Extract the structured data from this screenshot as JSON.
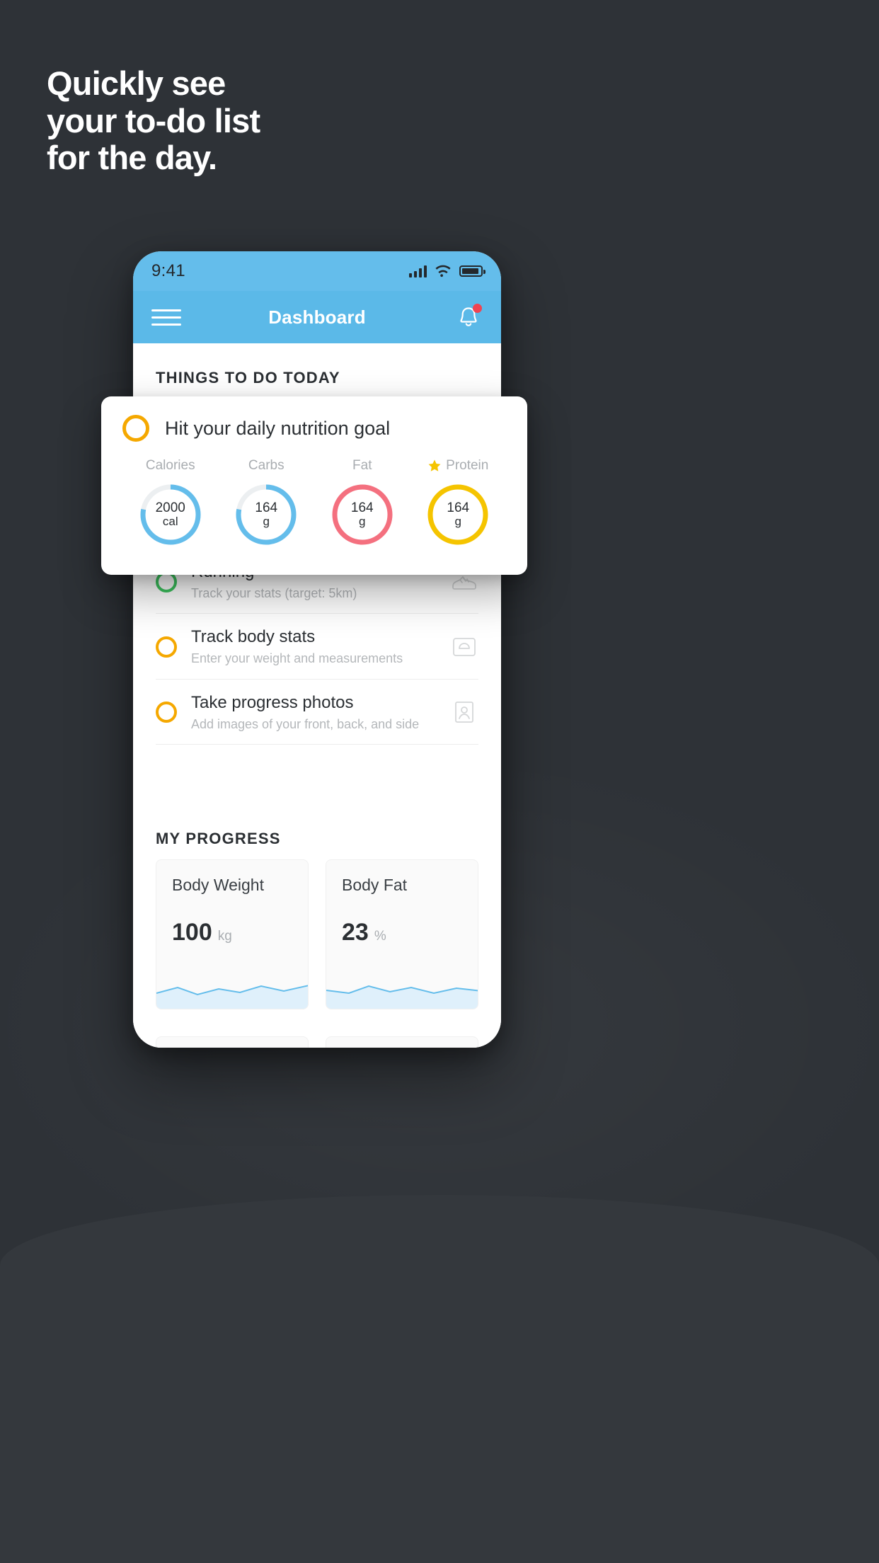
{
  "headline": {
    "line1": "Quickly see",
    "line2": "your to-do list",
    "line3": "for the day."
  },
  "colors": {
    "background": "#2e3237",
    "header_blue": "#5bb9e8",
    "status_blue": "#64bdeb",
    "amber": "#f5a800",
    "green": "#3dc45f",
    "red": "#f4707f",
    "light_blue": "#64bdeb",
    "yellow": "#f5c400",
    "notification_dot": "#ef4452"
  },
  "phone": {
    "status_bar": {
      "time": "9:41",
      "signal_icon": "cellular-signal-icon",
      "wifi_icon": "wifi-icon",
      "battery_icon": "battery-icon"
    },
    "app_bar": {
      "menu_icon": "hamburger-menu-icon",
      "title": "Dashboard",
      "bell_icon": "notification-bell-icon",
      "has_notification": true
    },
    "sections": {
      "todo_title": "THINGS TO DO TODAY",
      "progress_title": "MY PROGRESS"
    },
    "tasks": [
      {
        "title": "Running",
        "subtitle": "Track your stats (target: 5km)",
        "check_color": "#3dc45f",
        "icon": "running-shoe-icon"
      },
      {
        "title": "Track body stats",
        "subtitle": "Enter your weight and measurements",
        "check_color": "#f5a800",
        "icon": "scale-icon"
      },
      {
        "title": "Take progress photos",
        "subtitle": "Add images of your front, back, and side",
        "check_color": "#f5a800",
        "icon": "photo-portrait-icon"
      }
    ],
    "progress_cards": [
      {
        "label": "Body Weight",
        "value": "100",
        "unit": "kg"
      },
      {
        "label": "Body Fat",
        "value": "23",
        "unit": "%"
      }
    ]
  },
  "nutrition_card": {
    "check_color": "#f5a800",
    "title": "Hit your daily nutrition goal",
    "macros": [
      {
        "label": "Calories",
        "value": "2000",
        "unit": "cal",
        "color": "#64bdeb",
        "percent": 78,
        "starred": false
      },
      {
        "label": "Carbs",
        "value": "164",
        "unit": "g",
        "color": "#64bdeb",
        "percent": 78,
        "starred": false
      },
      {
        "label": "Fat",
        "value": "164",
        "unit": "g",
        "color": "#f4707f",
        "percent": 100,
        "starred": false
      },
      {
        "label": "Protein",
        "value": "164",
        "unit": "g",
        "color": "#f5c400",
        "percent": 100,
        "starred": true,
        "star_icon": "star-icon"
      }
    ]
  }
}
